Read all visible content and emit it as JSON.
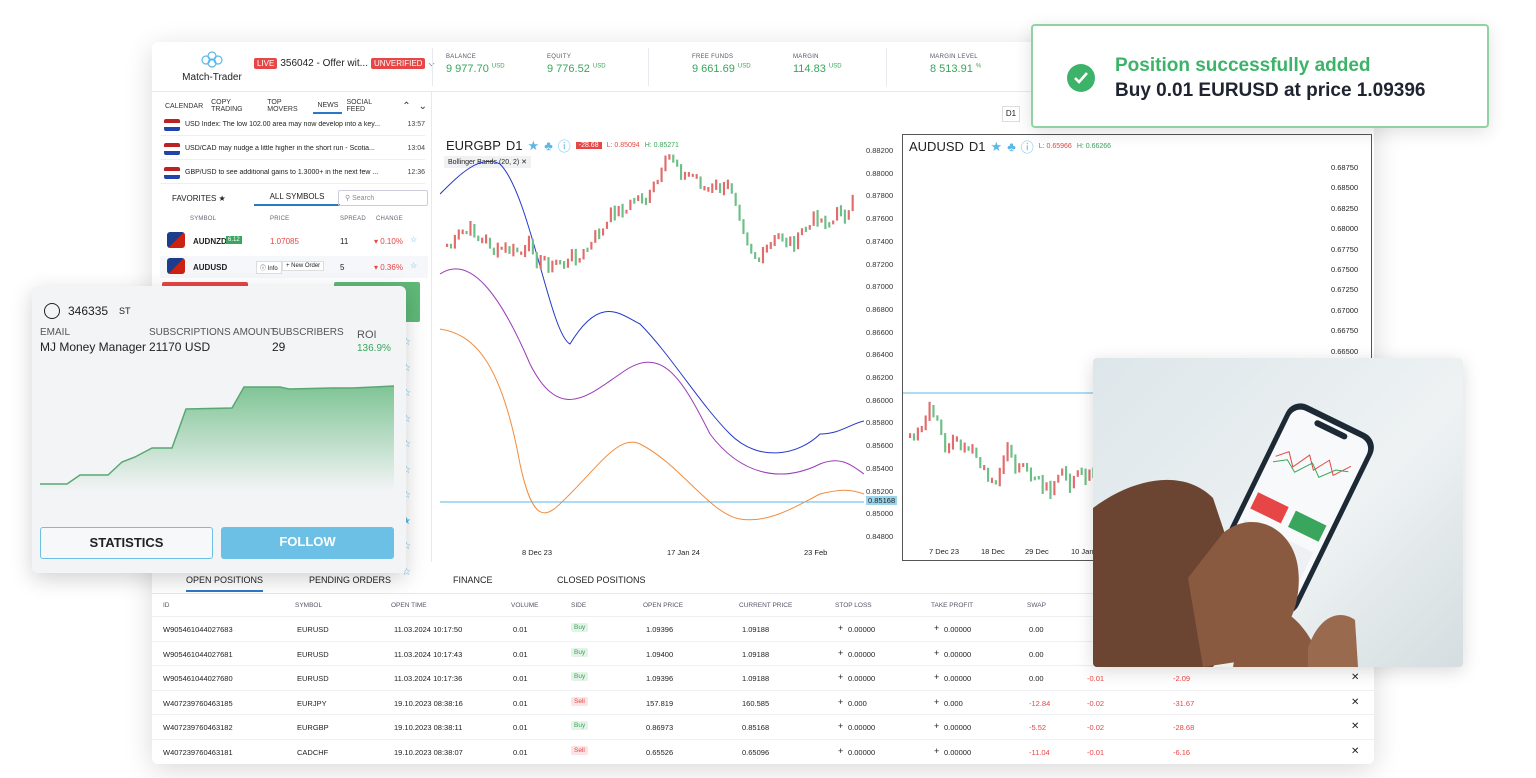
{
  "header": {
    "logo_text": "Match-Trader",
    "live_tag": "LIVE",
    "account": "356042 - Offer wit...",
    "unverified_tag": "UNVERIFIED",
    "metrics": [
      {
        "label": "BALANCE",
        "value": "9 977.70",
        "unit": "USD"
      },
      {
        "label": "EQUITY",
        "value": "9 776.52",
        "unit": "USD"
      },
      {
        "label": "FREE FUNDS",
        "value": "9 661.69",
        "unit": "USD"
      },
      {
        "label": "MARGIN",
        "value": "114.83",
        "unit": "USD"
      },
      {
        "label": "MARGIN LEVEL",
        "value": "8 513.91",
        "unit": "%"
      }
    ]
  },
  "news_tabs": [
    "CALENDAR",
    "COPY TRADING",
    "TOP MOVERS",
    "NEWS",
    "SOCIAL FEED"
  ],
  "news": [
    {
      "text": "USD Index: The low 102.00 area may now develop into a key...",
      "time": "13:57"
    },
    {
      "text": "USD/CAD may nudge a little higher in the short run - Scotia...",
      "time": "13:04"
    },
    {
      "text": "GBP/USD to see additional gains to 1.3000+ in the next few ...",
      "time": "12:36"
    }
  ],
  "symbols_panel": {
    "favorites_tab": "FAVORITES",
    "all_tab": "ALL SYMBOLS",
    "search_placeholder": "Search",
    "columns": [
      "SYMBOL",
      "PRICE",
      "SPREAD",
      "CHANGE"
    ],
    "rows": [
      {
        "symbol": "AUDNZD",
        "badge": "6.12",
        "price": "1.07085",
        "spread": "11",
        "change": "0.10%"
      },
      {
        "symbol": "AUDUSD",
        "info": "Info",
        "new_order": "+ New Order",
        "spread": "5",
        "change": "0.36%"
      }
    ]
  },
  "chart_main": {
    "symbol": "EURGBP",
    "tf": "D1",
    "change_badge": "-28.68",
    "low": "L: 0.85094",
    "high": "H: 0.85271",
    "indicator": "Bollinger Bands (20, 2)",
    "price_tag": "0.85168",
    "x_labels": [
      "8 Dec 23",
      "17 Jan 24",
      "23 Feb"
    ],
    "y_labels": [
      "0.88200",
      "0.88000",
      "0.87800",
      "0.87600",
      "0.87400",
      "0.87200",
      "0.87000",
      "0.86800",
      "0.86600",
      "0.86400",
      "0.86200",
      "0.86000",
      "0.85800",
      "0.85600",
      "0.85400",
      "0.85200",
      "0.85000",
      "0.84800"
    ]
  },
  "chart_second": {
    "symbol": "AUDUSD",
    "tf": "D1",
    "low": "L: 0.65966",
    "high": "H: 0.66266",
    "x_labels": [
      "7 Dec 23",
      "18 Dec",
      "29 Dec",
      "10 Jan"
    ],
    "y_labels": [
      "0.68750",
      "0.68500",
      "0.68250",
      "0.68000",
      "0.67750",
      "0.67500",
      "0.67250",
      "0.67000",
      "0.66750",
      "0.66500"
    ]
  },
  "tf_buttons": [
    "D1"
  ],
  "bottom_tabs": [
    "OPEN POSITIONS",
    "PENDING ORDERS",
    "FINANCE",
    "CLOSED POSITIONS"
  ],
  "table": {
    "columns": [
      "ID",
      "SYMBOL",
      "OPEN TIME",
      "VOLUME",
      "SIDE",
      "OPEN PRICE",
      "CURRENT PRICE",
      "STOP LOSS",
      "TAKE PROFIT",
      "SWAP"
    ],
    "rows": [
      {
        "id": "W905461044027683",
        "symbol": "EURUSD",
        "time": "11.03.2024 10:17:50",
        "vol": "0.01",
        "side": "Buy",
        "open": "1.09396",
        "cur": "1.09188",
        "sl": "0.00000",
        "tp": "0.00000",
        "swap": "0.00",
        "c1": "",
        "c2": ""
      },
      {
        "id": "W905461044027681",
        "symbol": "EURUSD",
        "time": "11.03.2024 10:17:43",
        "vol": "0.01",
        "side": "Buy",
        "open": "1.09400",
        "cur": "1.09188",
        "sl": "0.00000",
        "tp": "0.00000",
        "swap": "0.00",
        "c1": "",
        "c2": ""
      },
      {
        "id": "W905461044027680",
        "symbol": "EURUSD",
        "time": "11.03.2024 10:17:36",
        "vol": "0.01",
        "side": "Buy",
        "open": "1.09396",
        "cur": "1.09188",
        "sl": "0.00000",
        "tp": "0.00000",
        "swap": "0.00",
        "c1": "-0.01",
        "c2": "-2.09"
      },
      {
        "id": "W407239760463185",
        "symbol": "EURJPY",
        "time": "19.10.2023 08:38:16",
        "vol": "0.01",
        "side": "Sell",
        "open": "157.819",
        "cur": "160.585",
        "sl": "0.000",
        "tp": "0.000",
        "swap": "-12.84",
        "c1": "-0.02",
        "c2": "-31.67"
      },
      {
        "id": "W407239760463182",
        "symbol": "EURGBP",
        "time": "19.10.2023 08:38:11",
        "vol": "0.01",
        "side": "Buy",
        "open": "0.86973",
        "cur": "0.85168",
        "sl": "0.00000",
        "tp": "0.00000",
        "swap": "-5.52",
        "c1": "-0.02",
        "c2": "-28.68"
      },
      {
        "id": "W407239760463181",
        "symbol": "CADCHF",
        "time": "19.10.2023 08:38:07",
        "vol": "0.01",
        "side": "Sell",
        "open": "0.65526",
        "cur": "0.65096",
        "sl": "0.00000",
        "tp": "0.00000",
        "swap": "-11.04",
        "c1": "-0.01",
        "c2": "-6.16"
      }
    ]
  },
  "toast": {
    "title": "Position successfully added",
    "message": "Buy 0.01 EURUSD at price 1.09396"
  },
  "subscription_card": {
    "account_id": "346335",
    "account_type": "ST",
    "email_label": "EMAIL",
    "email_value": "MJ Money Manager",
    "amount_label": "SUBSCRIPTIONS AMOUNT",
    "amount_value": "21170 USD",
    "subscribers_label": "SUBSCRIBERS",
    "subscribers_value": "29",
    "roi_label": "ROI",
    "roi_value": "136.9%",
    "statistics_button": "STATISTICS",
    "follow_button": "FOLLOW"
  },
  "colors": {
    "green": "#3aa55d",
    "red": "#e64646",
    "blue": "#2a78c6",
    "follow": "#6cc0e6"
  }
}
